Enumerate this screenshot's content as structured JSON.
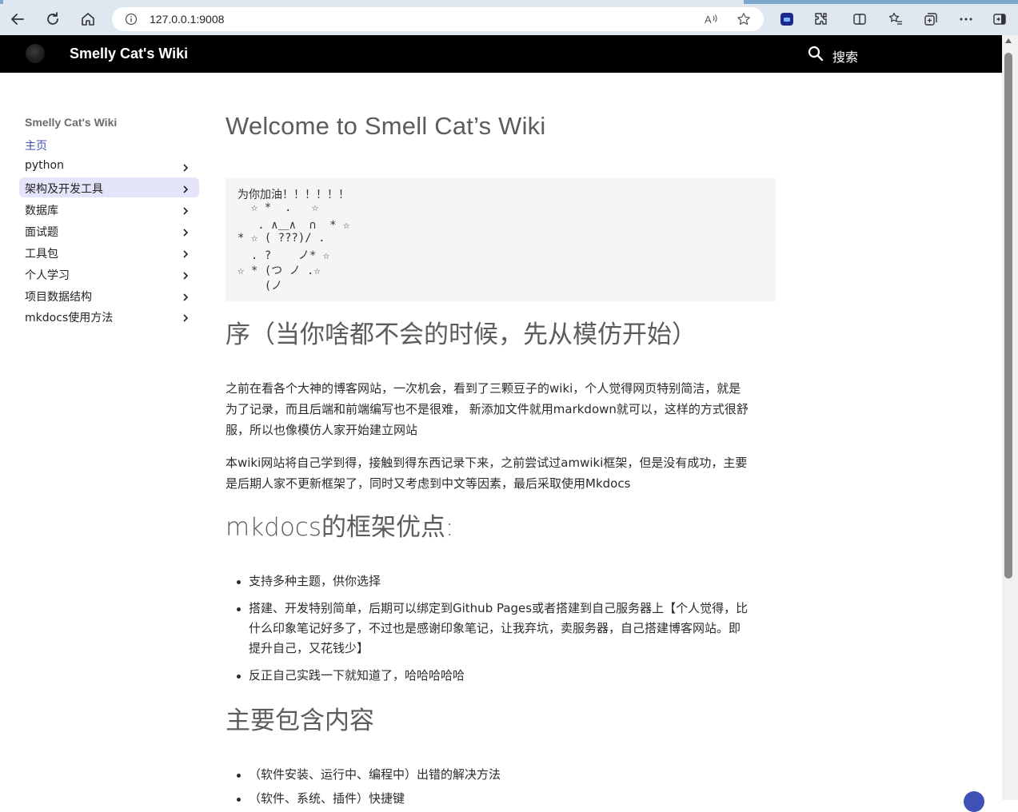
{
  "browser": {
    "url": "127.0.0.1:9008"
  },
  "header": {
    "site_title": "Smelly Cat's Wiki",
    "search_placeholder": "搜索"
  },
  "sidebar": {
    "heading": "Smelly Cat's Wiki",
    "items": [
      {
        "label": "主页",
        "active": false,
        "has_children": false
      },
      {
        "label": "python",
        "active": false,
        "has_children": true
      },
      {
        "label": "架构及开发工具",
        "active": true,
        "has_children": true
      },
      {
        "label": "数据库",
        "active": false,
        "has_children": true
      },
      {
        "label": "面试题",
        "active": false,
        "has_children": true
      },
      {
        "label": "工具包",
        "active": false,
        "has_children": true
      },
      {
        "label": "个人学习",
        "active": false,
        "has_children": true
      },
      {
        "label": "项目数据结构",
        "active": false,
        "has_children": true
      },
      {
        "label": "mkdocs使用方法",
        "active": false,
        "has_children": true
      }
    ]
  },
  "content": {
    "title": "Welcome to Smell Cat’s Wiki",
    "code_lines": [
      "为你加油！！！！！！",
      "  ☆ *  .   ☆",
      "   . ∧＿∧  ∩  * ☆",
      "* ☆ ( ???)/ .",
      "  . ?    ノ* ☆",
      "☆ * (つ ノ .☆",
      "    (ノ"
    ],
    "section_intro_heading": "序（当你啥都不会的时候，先从模仿开始）",
    "intro_paragraphs": [
      [
        "之前在看各个大神的博客网站，一次机会，看到了三颗豆子的wiki，个人觉得网页特别简洁，就是",
        "为了记录，而且后端和前端编写也不是很难， 新添加文件就用markdown就可以，这样的方式很舒",
        "服，所以也像模仿人家开始建立网站"
      ],
      [
        "本wiki网站将自己学到得，接触到得东西记录下来，之前尝试过amwiki框架，但是没有成功，主要",
        "是后期人家不更新框架了，同时又考虑到中文等因素，最后采取使用Mkdocs"
      ]
    ],
    "section_advantages_heading": "mkdocs的框架优点:",
    "advantages": [
      [
        "支持多种主题，供你选择"
      ],
      [
        "搭建、开发特别简单，后期可以绑定到Github Pages或者搭建到自己服务器上【个人觉得，比",
        "什么印象笔记好多了，不过也是感谢印象笔记，让我弃坑，卖服务器，自己搭建博客网站。即",
        "提升自己，又花钱少】"
      ],
      [
        "反正自己实践一下就知道了，哈哈哈哈哈"
      ]
    ],
    "section_contents_heading": "主要包含内容",
    "contents_items": [
      "（软件安装、运行中、编程中）出错的解决方法",
      "（软件、系统、插件）快捷键"
    ]
  },
  "colors": {
    "header_bg": "#000000",
    "accent": "#3f51b5",
    "active_nav_bg": "#e4e4fb"
  }
}
